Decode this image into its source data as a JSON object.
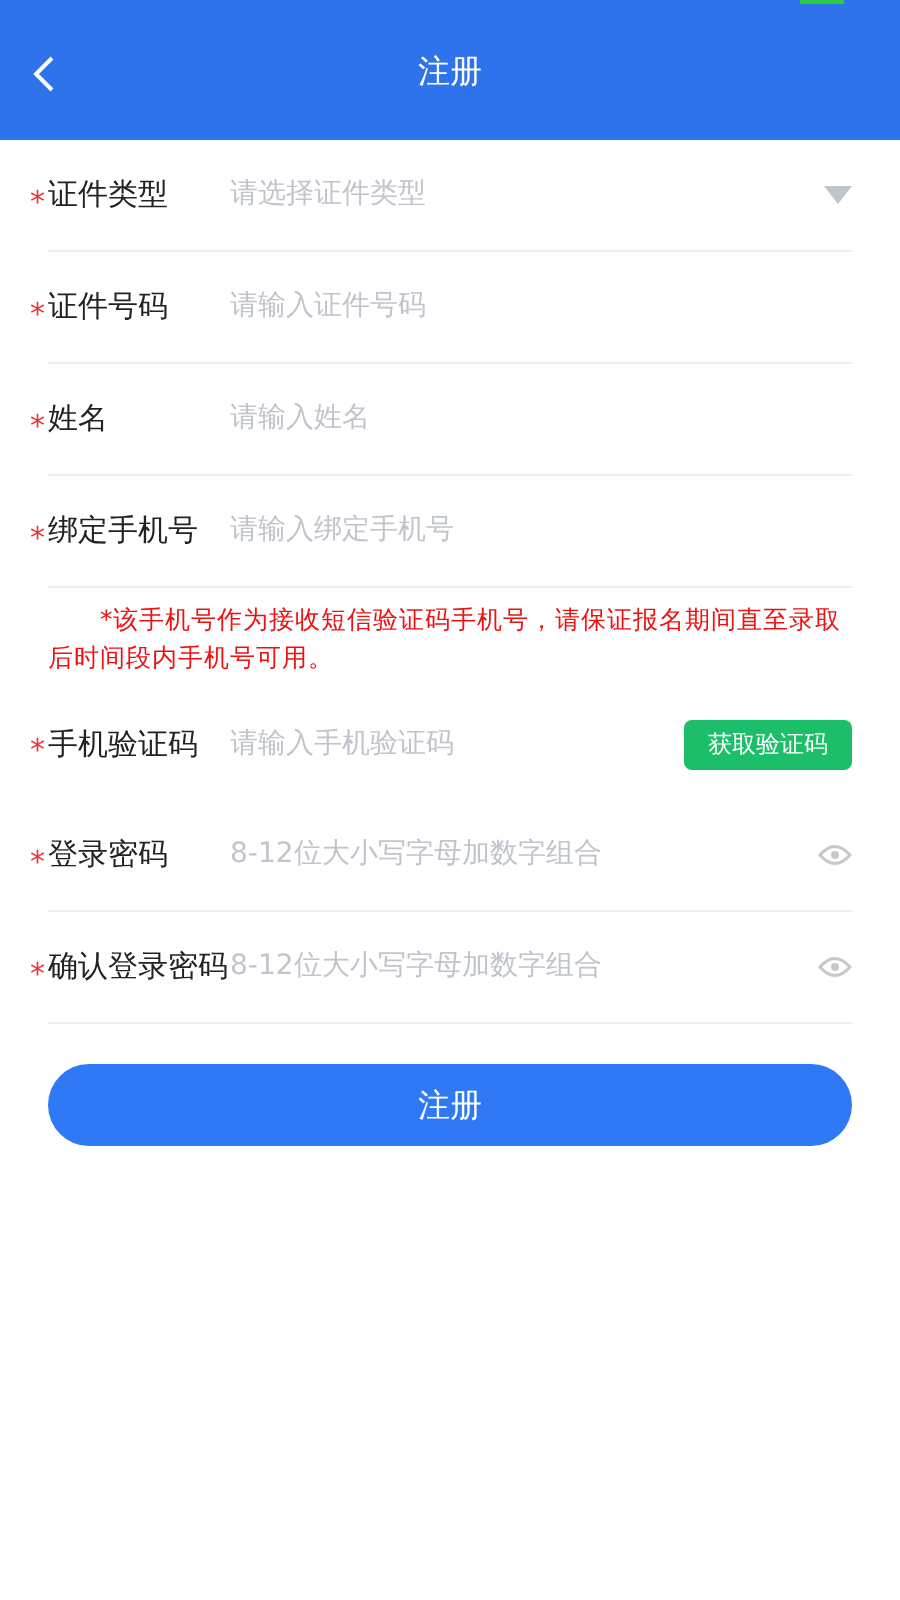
{
  "header": {
    "title": "注册"
  },
  "fields": [
    {
      "kind": "select",
      "mark": "*",
      "label": "证件类型",
      "placeholder": "请选择证件类型"
    },
    {
      "kind": "text",
      "mark": "*",
      "label": "证件号码",
      "placeholder": "请输入证件号码"
    },
    {
      "kind": "text",
      "mark": "*",
      "label": "姓名",
      "placeholder": "请输入姓名"
    },
    {
      "kind": "text",
      "mark": "*",
      "label": "绑定手机号",
      "placeholder": "请输入绑定手机号",
      "note": "*该手机号作为接收短信验证码手机号，请保证报名期间直至录取后时间段内手机号可用。"
    },
    {
      "kind": "sms",
      "mark": "*",
      "label": "手机验证码",
      "placeholder": "请输入手机验证码",
      "button": "获取验证码"
    },
    {
      "kind": "password",
      "mark": "*",
      "label": "登录密码",
      "placeholder": "8-12位大小写字母加数字组合"
    },
    {
      "kind": "password",
      "mark": "*",
      "label": "确认登录密码",
      "placeholder": "8-12位大小写字母加数字组合"
    }
  ],
  "submit": "注册"
}
